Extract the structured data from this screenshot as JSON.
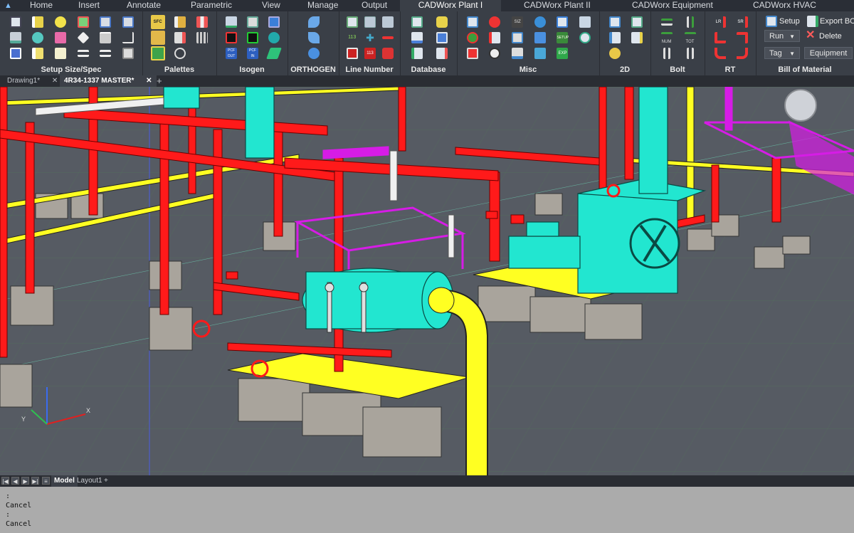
{
  "ribbon_tabs": [
    {
      "label": "Home"
    },
    {
      "label": "Insert"
    },
    {
      "label": "Annotate"
    },
    {
      "label": "Parametric"
    },
    {
      "label": "View"
    },
    {
      "label": "Manage"
    },
    {
      "label": "Output"
    },
    {
      "label": "CADWorx Plant I"
    },
    {
      "label": "CADWorx Plant II"
    },
    {
      "label": "CADWorx Equipment"
    },
    {
      "label": "CADWorx HVAC"
    }
  ],
  "active_tab": "CADWorx Plant I",
  "panels": {
    "setup_size_spec": "Setup Size/Spec",
    "palettes": "Palettes",
    "isogen": "Isogen",
    "orthogen": "ORTHOGEN",
    "line_number": "Line Number",
    "database": "Database",
    "misc": "Misc",
    "twod": "2D",
    "bolt": "Bolt",
    "rt": "RT",
    "bill_of_material": "Bill of Material"
  },
  "bom": {
    "setup_label": "Setup",
    "export_label": "Export BOM",
    "run_label": "Run",
    "delete_label": "Delete",
    "tag_label": "Tag",
    "equipment_label": "Equipment"
  },
  "icon_glyphs": {
    "sfc": "SFC",
    "line113": "113",
    "pcf_out": "PCF OUT",
    "pcf_in": "PCF IN",
    "siz": "SIZ",
    "setup_btn": "SETUP",
    "exp": "EXP",
    "bolt_num": "NUM",
    "bolt_tot": "TOT",
    "rt_lr": "LR",
    "rt_sr": "SR"
  },
  "doc_tabs": [
    {
      "label": "Drawing1*"
    },
    {
      "label": "4R34-1337 MASTER*"
    }
  ],
  "layout_tabs": [
    {
      "label": "Model"
    },
    {
      "label": "Layout1"
    }
  ],
  "axis": {
    "x": "X",
    "y": "Y"
  },
  "command_history": [
    ":",
    "Cancel",
    ":",
    "Cancel"
  ],
  "colors": {
    "pipe_red": "#ff1a1a",
    "pipe_yellow": "#ffff22",
    "equipment_cyan": "#22e6d0",
    "platform_magenta": "#d61ce6",
    "concrete": "#a9a49c",
    "viewport_bg": "#565b63",
    "ribbon_bg": "#3a3f47"
  }
}
